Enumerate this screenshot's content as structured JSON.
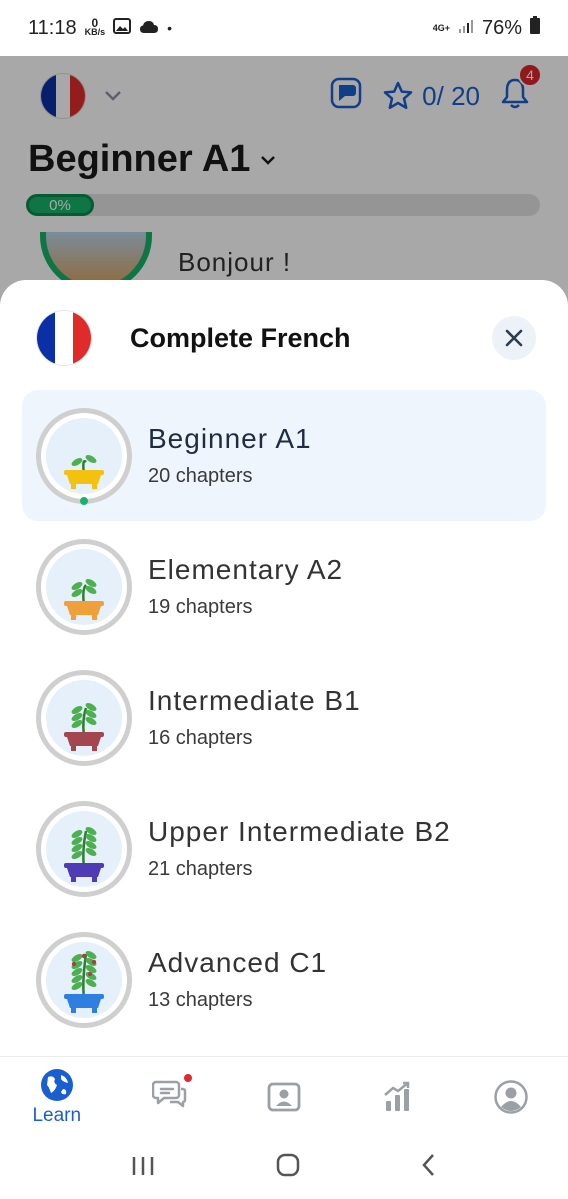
{
  "status_bar": {
    "time": "11:18",
    "data_rate_value": "0",
    "data_rate_unit": "KB/s",
    "network": "4G+",
    "battery": "76%"
  },
  "header": {
    "flag": [
      "#0b2fa6",
      "#ffffff",
      "#e02b2b"
    ],
    "stars_text": "0/ 20",
    "notifications_count": "4",
    "course_title": "Beginner A1",
    "progress_text": "0%",
    "progress_value": 0,
    "peek_lesson": "Bonjour !"
  },
  "sheet": {
    "title": "Complete French",
    "close_icon": "close-icon",
    "levels": [
      {
        "name": "Beginner A1",
        "chapters": "20 chapters",
        "pot_color": "#f2c20f",
        "active": true
      },
      {
        "name": "Elementary A2",
        "chapters": "19 chapters",
        "pot_color": "#f0a03a",
        "active": false
      },
      {
        "name": "Intermediate B1",
        "chapters": "16 chapters",
        "pot_color": "#a3464f",
        "active": false
      },
      {
        "name": "Upper Intermediate B2",
        "chapters": "21 chapters",
        "pot_color": "#4f3bb5",
        "active": false
      },
      {
        "name": "Advanced C1",
        "chapters": "13 chapters",
        "pot_color": "#2f7fe0",
        "active": false
      }
    ]
  },
  "bottom_nav": {
    "learn_label": "Learn",
    "items": [
      "globe-icon",
      "chat-icon",
      "person-card-icon",
      "stats-icon",
      "profile-icon"
    ]
  },
  "colors": {
    "accent": "#1a5fd0",
    "progress_green": "#17b26a",
    "badge_red": "#d9262c"
  }
}
